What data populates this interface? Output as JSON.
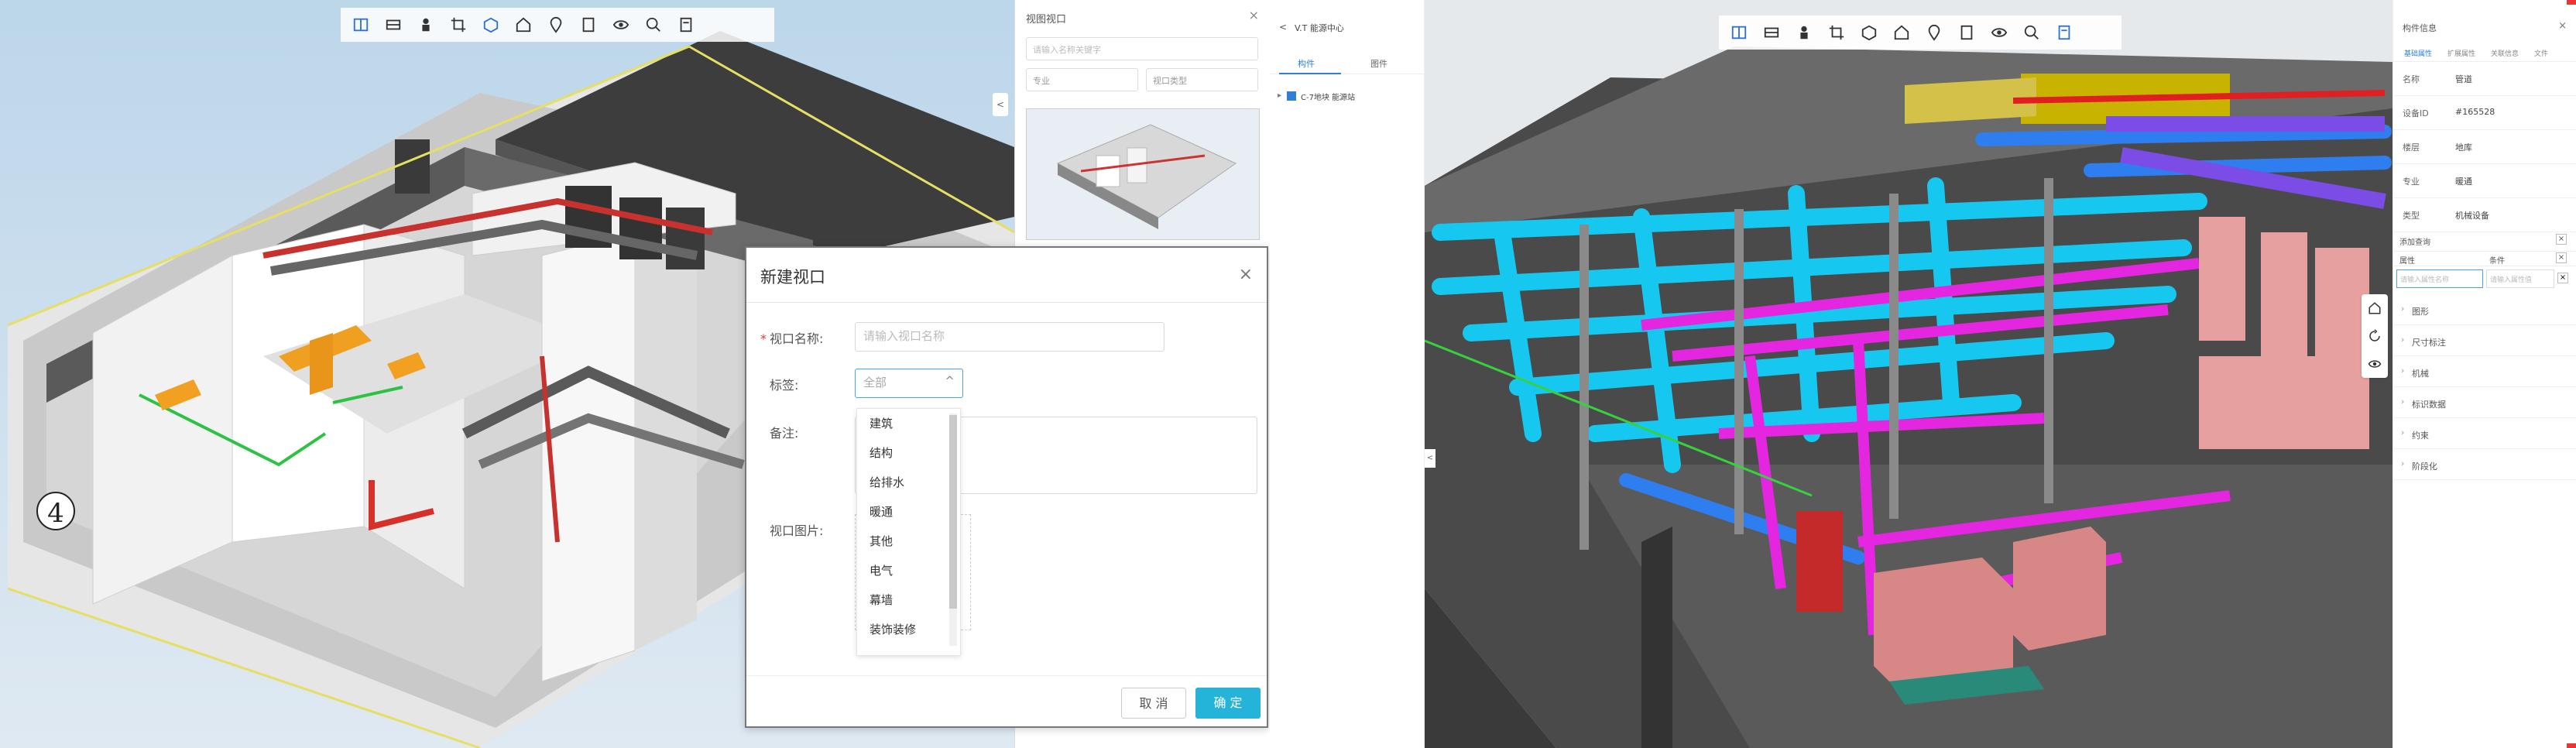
{
  "left": {
    "toolbar_icons": [
      "split-view-icon",
      "section-icon",
      "person-icon",
      "crop-icon",
      "cube-icon",
      "home-icon",
      "location-icon",
      "document-icon",
      "eye-icon",
      "search-icon",
      "file-icon"
    ],
    "circle_label": "4",
    "viewport_panel": {
      "title": "视图视口",
      "close": "×",
      "search_placeholder": "请输入名称关键字",
      "filter1": "专业",
      "filter2": "视口类型"
    },
    "dialog": {
      "title": "新建视口",
      "close": "×",
      "name_label": "视口名称:",
      "name_placeholder": "请输入视口名称",
      "tag_label": "标签:",
      "tag_value": "全部",
      "remark_label": "备注:",
      "image_label": "视口图片:",
      "dropdown_options": [
        "建筑",
        "结构",
        "给排水",
        "暖通",
        "其他",
        "电气",
        "幕墙",
        "装饰装修"
      ],
      "cancel": "取 消",
      "confirm": "确 定"
    }
  },
  "right": {
    "tree": {
      "back": "<",
      "title": "V.T 能源中心",
      "tabs": [
        "构件",
        "图件"
      ],
      "item": "C-7地块 能源站"
    },
    "toolbar_icons": [
      "split-view-icon",
      "section-icon",
      "person-icon",
      "crop-icon",
      "cube-icon",
      "home-icon",
      "location-icon",
      "document-icon",
      "eye-icon",
      "search-icon",
      "file-icon"
    ],
    "props": {
      "title": "构件信息",
      "close": "×",
      "tabs": [
        "基础属性",
        "扩展属性",
        "关联信息",
        "文件"
      ],
      "rows": [
        {
          "k": "名称",
          "v": "管道"
        },
        {
          "k": "设备ID",
          "v": "#165528"
        },
        {
          "k": "楼层",
          "v": "地库"
        },
        {
          "k": "专业",
          "v": "暖通"
        },
        {
          "k": "类型",
          "v": "机械设备"
        }
      ],
      "search_title": "添加查询",
      "search_cols": [
        "属性",
        "条件"
      ],
      "search_placeholder1": "请输入属性名称",
      "search_placeholder2": "请输入属性值",
      "groups": [
        "图形",
        "尺寸标注",
        "机械",
        "标识数据",
        "约束",
        "阶段化"
      ]
    }
  }
}
